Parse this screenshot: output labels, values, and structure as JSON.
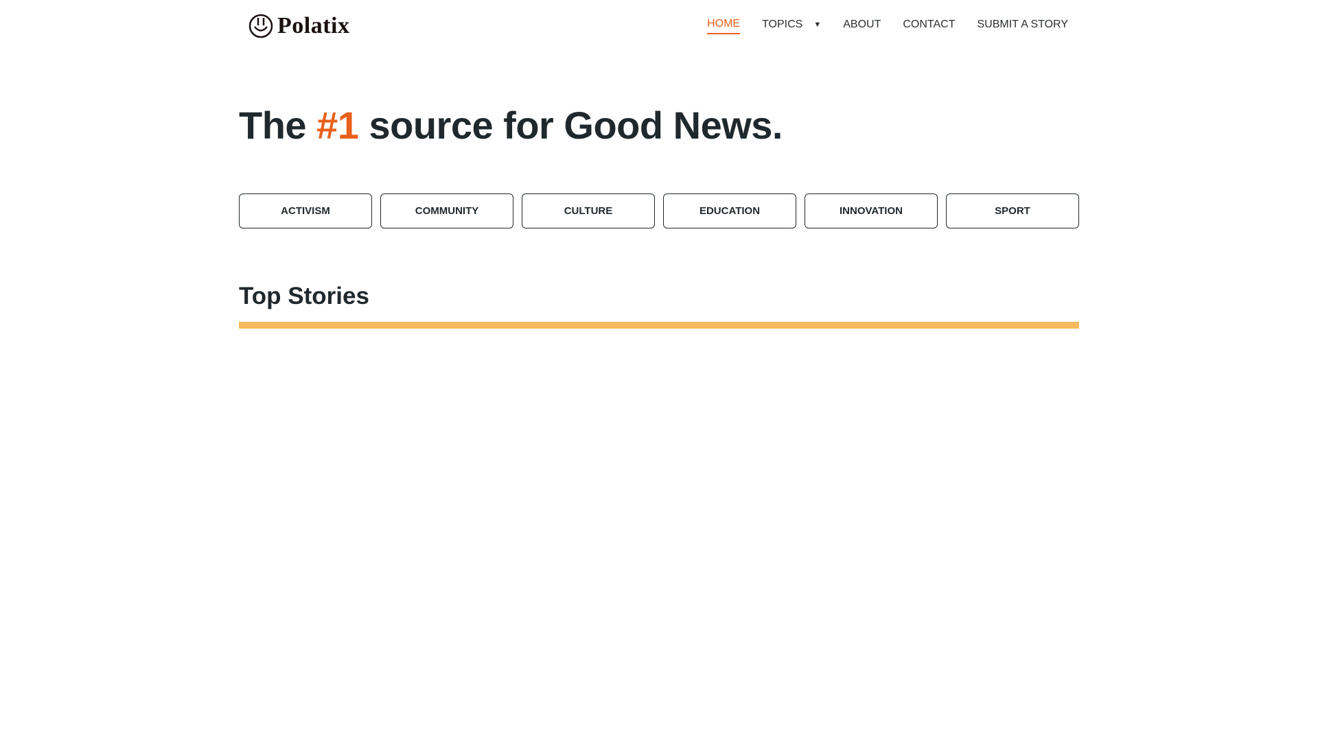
{
  "header": {
    "logo_text": "Polatix",
    "nav": [
      {
        "label": "HOME",
        "active": true
      },
      {
        "label": "TOPICS",
        "has_dropdown": true
      },
      {
        "label": "ABOUT"
      },
      {
        "label": "CONTACT"
      },
      {
        "label": "SUBMIT A STORY"
      }
    ]
  },
  "hero": {
    "prefix": "The ",
    "accent": "#1",
    "suffix": " source for Good News."
  },
  "categories": [
    "ACTIVISM",
    "COMMUNITY",
    "CULTURE",
    "EDUCATION",
    "INNOVATION",
    "SPORT"
  ],
  "section": {
    "title": "Top Stories"
  },
  "colors": {
    "accent": "#e8601c",
    "divider": "#f6bb5e",
    "text": "#1f282d"
  }
}
